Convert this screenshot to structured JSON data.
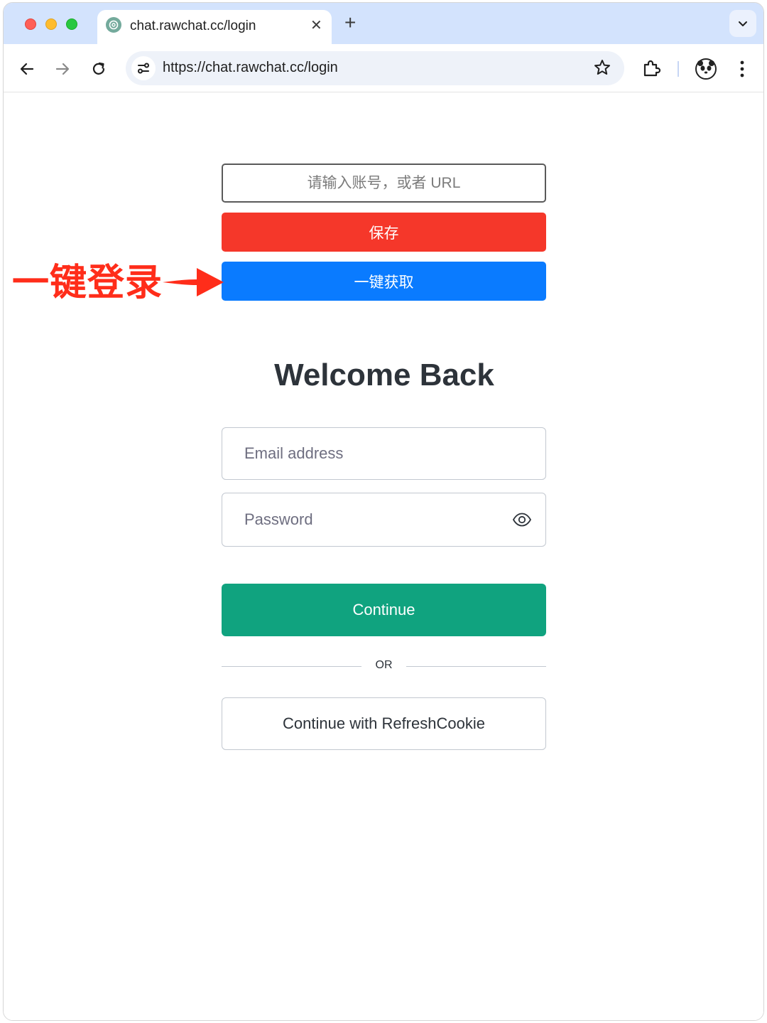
{
  "browser": {
    "tab": {
      "title": "chat.rawchat.cc/login",
      "close": "✕"
    },
    "new_tab": "+",
    "url": "https://chat.rawchat.cc/login"
  },
  "page": {
    "account_input": {
      "placeholder": "请输入账号，或者 URL",
      "value": ""
    },
    "save_button": "保存",
    "fetch_button": "一键获取",
    "annotation": {
      "label": "一键登录",
      "color": "#ff2d1a"
    },
    "heading": "Welcome Back",
    "email": {
      "placeholder": "Email address",
      "value": ""
    },
    "password": {
      "placeholder": "Password",
      "value": ""
    },
    "continue_button": "Continue",
    "divider_text": "OR",
    "refresh_button": "Continue with RefreshCookie"
  },
  "colors": {
    "save": "#f5372a",
    "fetch": "#0a7bff",
    "continue": "#10a37f",
    "tabstrip": "#d3e3fd"
  },
  "icons": [
    "back-arrow-icon",
    "forward-arrow-icon",
    "reload-icon",
    "site-info-icon",
    "star-icon",
    "extensions-icon",
    "avatar-icon",
    "more-icon",
    "eye-icon",
    "chevron-down-icon",
    "openai-favicon"
  ]
}
